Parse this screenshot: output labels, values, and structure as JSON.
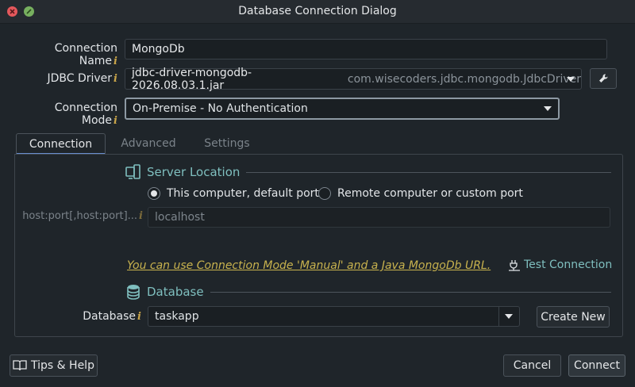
{
  "window": {
    "title": "Database Connection Dialog"
  },
  "form": {
    "connection_name_label": "Connection Name",
    "connection_name_value": "MongoDb",
    "jdbc_driver_label": "JDBC Driver",
    "jdbc_driver_main": "jdbc-driver-mongodb-2026.08.03.1.jar",
    "jdbc_driver_class": "com.wisecoders.jdbc.mongodb.JdbcDriver",
    "connection_mode_label": "Connection Mode",
    "connection_mode_value": "On-Premise - No Authentication",
    "info_glyph": "i"
  },
  "tabs": [
    {
      "label": "Connection",
      "active": true
    },
    {
      "label": "Advanced",
      "active": false
    },
    {
      "label": "Settings",
      "active": false
    }
  ],
  "connection": {
    "server_location_title": "Server Location",
    "radio_local": "This computer, default port",
    "radio_remote": "Remote computer or custom port",
    "radio_selected": "local",
    "host_label": "host:port[,host:port]...",
    "host_value": "localhost",
    "manual_hint": "You can use Connection Mode 'Manual' and a Java MongoDb URL.",
    "test_connection": "Test Connection",
    "database_title": "Database",
    "database_label": "Database",
    "database_value": "taskapp",
    "create_new": "Create New"
  },
  "footer": {
    "tips_help": "Tips & Help",
    "cancel": "Cancel",
    "connect": "Connect"
  },
  "colors": {
    "background": "#1f252a",
    "section_title": "#7fbfbf",
    "hint_link": "#c9b34e",
    "info_icon": "#c9a54a",
    "tab_underline": "#6a8fd0"
  },
  "icons": {
    "close": "close-icon",
    "maximize": "maximize-icon",
    "driver_settings": "wrench-icon",
    "server_location": "devices-icon",
    "database": "database-icon",
    "test_connection": "plug-icon",
    "tips": "book-icon"
  }
}
